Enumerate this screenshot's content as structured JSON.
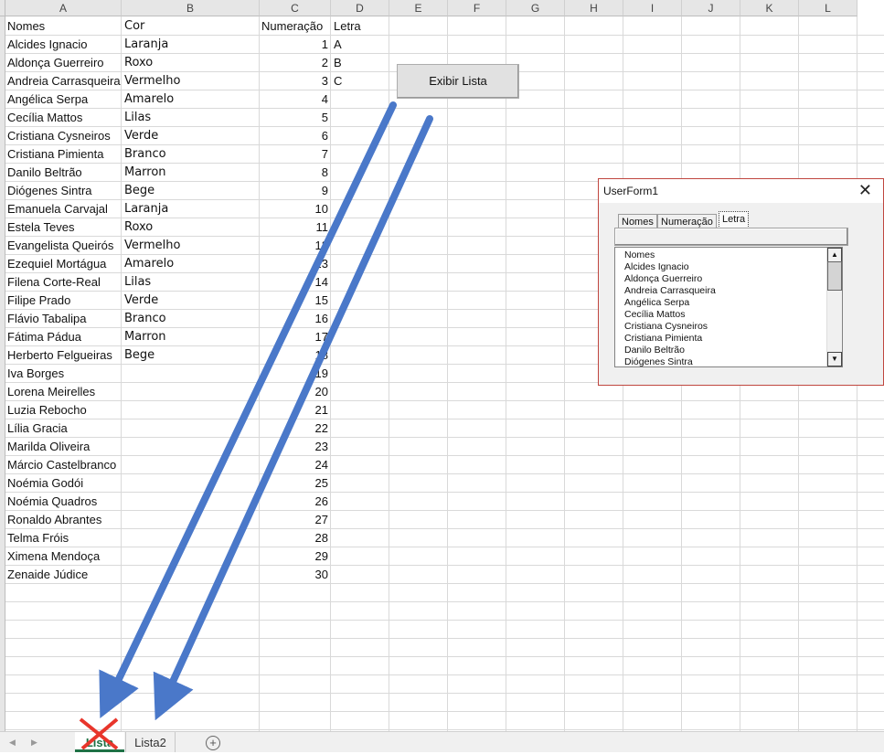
{
  "columns": [
    "A",
    "B",
    "C",
    "D",
    "E",
    "F",
    "G",
    "H",
    "I",
    "J",
    "K",
    "L"
  ],
  "headers": {
    "nomes": "Nomes",
    "cor": "Cor",
    "numeracao": "Numeração",
    "letra": "Letra"
  },
  "rows": [
    {
      "nome": "Alcides Ignacio",
      "cor": "Laranja",
      "num": "1",
      "letra": "A"
    },
    {
      "nome": "Aldonça Guerreiro",
      "cor": "Roxo",
      "num": "2",
      "letra": "B"
    },
    {
      "nome": "Andreia Carrasqueira",
      "cor": "Vermelho",
      "num": "3",
      "letra": "C"
    },
    {
      "nome": "Angélica Serpa",
      "cor": "Amarelo",
      "num": "4",
      "letra": ""
    },
    {
      "nome": "Cecília Mattos",
      "cor": "Lilas",
      "num": "5",
      "letra": ""
    },
    {
      "nome": "Cristiana Cysneiros",
      "cor": "Verde",
      "num": "6",
      "letra": ""
    },
    {
      "nome": "Cristiana Pimienta",
      "cor": "Branco",
      "num": "7",
      "letra": ""
    },
    {
      "nome": "Danilo Beltrão",
      "cor": "Marron",
      "num": "8",
      "letra": ""
    },
    {
      "nome": "Diógenes Sintra",
      "cor": "Bege",
      "num": "9",
      "letra": ""
    },
    {
      "nome": "Emanuela Carvajal",
      "cor": "Laranja",
      "num": "10",
      "letra": ""
    },
    {
      "nome": "Estela Teves",
      "cor": "Roxo",
      "num": "11",
      "letra": ""
    },
    {
      "nome": "Evangelista Queirós",
      "cor": "Vermelho",
      "num": "12",
      "letra": ""
    },
    {
      "nome": "Ezequiel Mortágua",
      "cor": "Amarelo",
      "num": "13",
      "letra": ""
    },
    {
      "nome": "Filena Corte-Real",
      "cor": "Lilas",
      "num": "14",
      "letra": ""
    },
    {
      "nome": "Filipe Prado",
      "cor": "Verde",
      "num": "15",
      "letra": ""
    },
    {
      "nome": "Flávio Tabalipa",
      "cor": "Branco",
      "num": "16",
      "letra": ""
    },
    {
      "nome": "Fátima Pádua",
      "cor": "Marron",
      "num": "17",
      "letra": ""
    },
    {
      "nome": "Herberto Felgueiras",
      "cor": "Bege",
      "num": "18",
      "letra": ""
    },
    {
      "nome": "Iva Borges",
      "cor": "",
      "num": "19",
      "letra": ""
    },
    {
      "nome": "Lorena Meirelles",
      "cor": "",
      "num": "20",
      "letra": ""
    },
    {
      "nome": "Luzia Rebocho",
      "cor": "",
      "num": "21",
      "letra": ""
    },
    {
      "nome": "Lília Gracia",
      "cor": "",
      "num": "22",
      "letra": ""
    },
    {
      "nome": "Marilda Oliveira",
      "cor": "",
      "num": "23",
      "letra": ""
    },
    {
      "nome": "Márcio Castelbranco",
      "cor": "",
      "num": "24",
      "letra": ""
    },
    {
      "nome": "Noémia Godói",
      "cor": "",
      "num": "25",
      "letra": ""
    },
    {
      "nome": "Noémia Quadros",
      "cor": "",
      "num": "26",
      "letra": ""
    },
    {
      "nome": "Ronaldo Abrantes",
      "cor": "",
      "num": "27",
      "letra": ""
    },
    {
      "nome": "Telma Fróis",
      "cor": "",
      "num": "28",
      "letra": ""
    },
    {
      "nome": "Ximena Mendoça",
      "cor": "",
      "num": "29",
      "letra": ""
    },
    {
      "nome": "Zenaide Júdice",
      "cor": "",
      "num": "30",
      "letra": ""
    }
  ],
  "button": {
    "label": "Exibir Lista"
  },
  "userform": {
    "title": "UserForm1",
    "close_glyph": "✕",
    "tabs": [
      "Nomes",
      "Numeração",
      "Letra"
    ],
    "active_tab": "Letra",
    "list_items": [
      "Nomes",
      "Alcides Ignacio",
      "Aldonça Guerreiro",
      "Andreia Carrasqueira",
      "Angélica Serpa",
      "Cecília Mattos",
      "Cristiana Cysneiros",
      "Cristiana Pimienta",
      "Danilo Beltrão",
      "Diógenes Sintra"
    ]
  },
  "sheet_tabs": {
    "active": "Lista",
    "other": "Lista2",
    "add_glyph": "+"
  },
  "colors": {
    "arrow": "#4a78c9",
    "cross": "#e8352b",
    "active_tab_text": "#1e7145",
    "form_border": "#c0463f"
  }
}
